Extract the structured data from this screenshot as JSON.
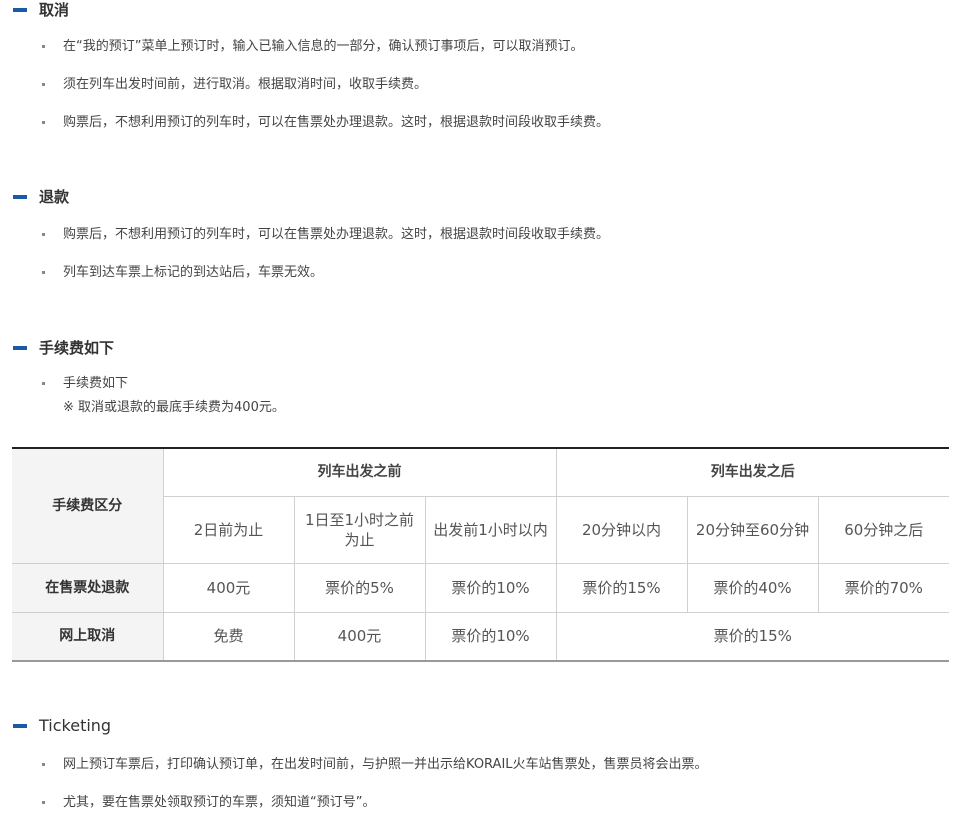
{
  "sections": {
    "cancel": {
      "title": "取消",
      "items": [
        "在“我的预订”菜单上预订时，输入已输入信息的一部分，确认预订事项后，可以取消预订。",
        "须在列车出发时间前，进行取消。根据取消时间，收取手续费。",
        "购票后，不想利用预订的列车时，可以在售票处办理退款。这时，根据退款时间段收取手续费。"
      ]
    },
    "refund": {
      "title": "退款",
      "items": [
        "购票后，不想利用预订的列车时，可以在售票处办理退款。这时，根据退款时间段收取手续费。",
        "列车到达车票上标记的到达站后，车票无效。"
      ]
    },
    "fees": {
      "title": "手续费如下",
      "items": [
        "手续费如下"
      ],
      "note": "※ 取消或退款的最底手续费为400元。"
    },
    "ticketing": {
      "title": "Ticketing",
      "items": [
        "网上预订车票后，打印确认预订单，在出发时间前，与护照一并出示给KORAIL火车站售票处，售票员将会出票。",
        "尤其，要在售票处领取预订的车票，须知道“预订号”。"
      ]
    }
  },
  "fee_table": {
    "corner": "手续费区分",
    "group_before": "列车出发之前",
    "group_after": "列车出发之后",
    "periods": [
      "2日前为止",
      "1日至1小时之前为止",
      "出发前1小时以内",
      "20分钟以内",
      "20分钟至60分钟",
      "60分钟之后"
    ],
    "rows": [
      {
        "label": "在售票处退款",
        "cells": [
          "400元",
          "票价的5%",
          "票价的10%",
          "票价的15%",
          "票价的40%",
          "票价的70%"
        ]
      },
      {
        "label": "网上取消",
        "cells": [
          "免费",
          "400元",
          "票价的10%",
          "票价的15%"
        ]
      }
    ]
  },
  "colors": {
    "accent_bar": "#1a5aa6",
    "row_header_bg": "#f4f4f4"
  }
}
